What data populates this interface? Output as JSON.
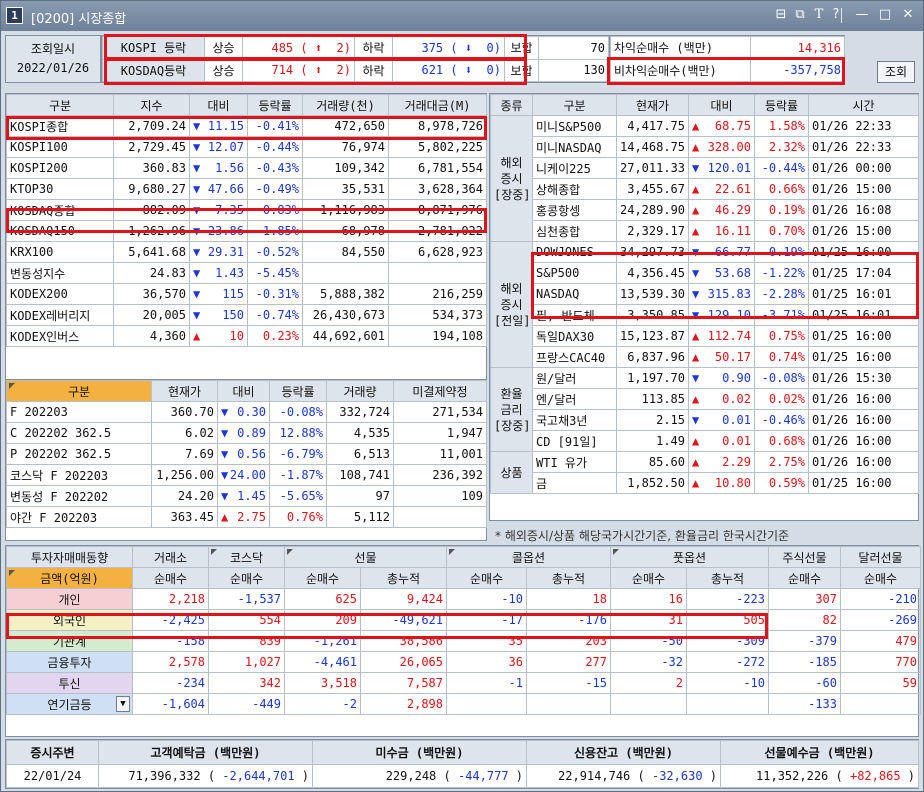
{
  "window": {
    "badge": "1",
    "title": "[0200] 시장종합",
    "controls": [
      "⊟",
      "⧉",
      "T",
      "?",
      "|",
      "—",
      "□",
      "✕"
    ]
  },
  "top": {
    "time_label": "조회일시",
    "date": "2022/01/26",
    "rows": [
      {
        "name": "KOSPI 등락",
        "up_label": "상승",
        "up_count": "485",
        "up_arrow": "⬆",
        "up_limit": "2",
        "down_label": "하락",
        "down_count": "375",
        "down_arrow": "⬇",
        "down_limit": "0",
        "extra_label": "보합",
        "extra_value": "70"
      },
      {
        "name": "KOSDAQ등락",
        "up_label": "상승",
        "up_count": "714",
        "up_arrow": "⬆",
        "up_limit": "2",
        "down_label": "하락",
        "down_count": "621",
        "down_arrow": "⬇",
        "down_limit": "0",
        "extra_label": "보합",
        "extra_value": "130"
      }
    ],
    "arb": [
      {
        "label": "차익순매수 (백만)",
        "value": "14,316"
      },
      {
        "label": "비차익순매수(백만)",
        "value": "-357,758"
      }
    ],
    "query_button": "조회"
  },
  "index_table": {
    "headers": [
      "구분",
      "지수",
      "대비",
      "등락률",
      "거래량(천)",
      "거래대금(M)"
    ],
    "rows": [
      {
        "name": "KOSPI종합",
        "value": "2,709.24",
        "dir": "down",
        "change": "11.15",
        "rate": "-0.41%",
        "volume": "472,650",
        "amount": "8,978,726"
      },
      {
        "name": "KOSPI100",
        "value": "2,729.45",
        "dir": "down",
        "change": "12.07",
        "rate": "-0.44%",
        "volume": "76,974",
        "amount": "5,802,225"
      },
      {
        "name": "KOSPI200",
        "value": "360.83",
        "dir": "down",
        "change": "1.56",
        "rate": "-0.43%",
        "volume": "109,342",
        "amount": "6,781,554"
      },
      {
        "name": "KTOP30",
        "value": "9,680.27",
        "dir": "down",
        "change": "47.66",
        "rate": "-0.49%",
        "volume": "35,531",
        "amount": "3,628,364"
      },
      {
        "name": "KOSDAQ종합",
        "value": "882.09",
        "dir": "down",
        "change": "7.35",
        "rate": "-0.83%",
        "volume": "1,116,983",
        "amount": "8,871,976"
      },
      {
        "name": "KOSDAQ150",
        "value": "1,262.96",
        "dir": "down",
        "change": "23.86",
        "rate": "-1.85%",
        "volume": "68,978",
        "amount": "2,781,022"
      },
      {
        "name": "KRX100",
        "value": "5,641.68",
        "dir": "down",
        "change": "29.31",
        "rate": "-0.52%",
        "volume": "84,550",
        "amount": "6,628,923"
      },
      {
        "name": "변동성지수",
        "value": "24.83",
        "dir": "down",
        "change": "1.43",
        "rate": "-5.45%",
        "volume": "",
        "amount": ""
      },
      {
        "name": "KODEX200",
        "value": "36,570",
        "dir": "down",
        "change": "115",
        "rate": "-0.31%",
        "volume": "5,888,382",
        "amount": "216,259"
      },
      {
        "name": "KODEX레버리지",
        "value": "20,005",
        "dir": "down",
        "change": "150",
        "rate": "-0.74%",
        "volume": "26,430,673",
        "amount": "534,373"
      },
      {
        "name": "KODEX인버스",
        "value": "4,360",
        "dir": "up",
        "change": "10",
        "rate": "0.23%",
        "volume": "44,692,601",
        "amount": "194,108"
      }
    ]
  },
  "futures_table": {
    "headers": [
      "구분",
      "현재가",
      "대비",
      "등락률",
      "거래량",
      "미결제약정"
    ],
    "rows": [
      {
        "name": "F 202203",
        "price": "360.70",
        "dir": "down",
        "change": "0.30",
        "rate": "-0.08%",
        "volume": "332,724",
        "oi": "271,534"
      },
      {
        "name": "C 202202 362.5",
        "price": "6.02",
        "dir": "down",
        "change": "0.89",
        "rate": "12.88%",
        "volume": "4,535",
        "oi": "1,947"
      },
      {
        "name": "P 202202 362.5",
        "price": "7.69",
        "dir": "down",
        "change": "0.56",
        "rate": "-6.79%",
        "volume": "6,513",
        "oi": "11,001"
      },
      {
        "name": "코스닥 F 202203",
        "price": "1,256.00",
        "dir": "down",
        "change": "24.00",
        "rate": "-1.87%",
        "volume": "108,741",
        "oi": "236,392"
      },
      {
        "name": "변동성 F 202202",
        "price": "24.20",
        "dir": "down",
        "change": "1.45",
        "rate": "-5.65%",
        "volume": "97",
        "oi": "109"
      },
      {
        "name": "야간 F 202203",
        "price": "363.45",
        "dir": "up",
        "change": "2.75",
        "rate": "0.76%",
        "volume": "5,112",
        "oi": ""
      }
    ]
  },
  "global_table": {
    "headers": [
      "종류",
      "구분",
      "현재가",
      "대비",
      "등락률",
      "시간"
    ],
    "groups": [
      {
        "label": [
          "해외",
          "증시",
          "[장중]"
        ],
        "rows": [
          {
            "name": "미니S&P500",
            "price": "4,417.75",
            "dir": "up",
            "change": "68.75",
            "rate": "1.58%",
            "time": "01/26 22:33"
          },
          {
            "name": "미니NASDAQ",
            "price": "14,468.75",
            "dir": "up",
            "change": "328.00",
            "rate": "2.32%",
            "time": "01/26 22:33"
          },
          {
            "name": "니케이225",
            "price": "27,011.33",
            "dir": "down",
            "change": "120.01",
            "rate": "-0.44%",
            "time": "01/26 00:00"
          },
          {
            "name": "상해종합",
            "price": "3,455.67",
            "dir": "up",
            "change": "22.61",
            "rate": "0.66%",
            "time": "01/26 15:00"
          },
          {
            "name": "홍콩항셍",
            "price": "24,289.90",
            "dir": "up",
            "change": "46.29",
            "rate": "0.19%",
            "time": "01/26 16:08"
          },
          {
            "name": "심천종합",
            "price": "2,329.17",
            "dir": "up",
            "change": "16.11",
            "rate": "0.70%",
            "time": "01/26 15:00"
          }
        ]
      },
      {
        "label": [
          "해외",
          "증시",
          "[전일]"
        ],
        "rows": [
          {
            "name": "DOWJONES",
            "price": "34,297.73",
            "dir": "down",
            "change": "66.77",
            "rate": "-0.19%",
            "time": "01/25 16:00"
          },
          {
            "name": "S&P500",
            "price": "4,356.45",
            "dir": "down",
            "change": "53.68",
            "rate": "-1.22%",
            "time": "01/25 17:04"
          },
          {
            "name": "NASDAQ",
            "price": "13,539.30",
            "dir": "down",
            "change": "315.83",
            "rate": "-2.28%",
            "time": "01/25 16:01"
          },
          {
            "name": "필, 반도체",
            "price": "3,350.85",
            "dir": "down",
            "change": "129.10",
            "rate": "-3.71%",
            "time": "01/25 16:01"
          },
          {
            "name": "독일DAX30",
            "price": "15,123.87",
            "dir": "up",
            "change": "112.74",
            "rate": "0.75%",
            "time": "01/25 16:00"
          },
          {
            "name": "프랑스CAC40",
            "price": "6,837.96",
            "dir": "up",
            "change": "50.17",
            "rate": "0.74%",
            "time": "01/25 16:00"
          }
        ]
      },
      {
        "label": [
          "환율",
          "금리",
          "[장중]"
        ],
        "rows": [
          {
            "name": "원/달러",
            "price": "1,197.70",
            "dir": "down",
            "change": "0.90",
            "rate": "-0.08%",
            "time": "01/26 15:30"
          },
          {
            "name": "엔/달러",
            "price": "113.85",
            "dir": "up",
            "change": "0.02",
            "rate": "0.02%",
            "time": "01/26 16:00"
          },
          {
            "name": "국고채3년",
            "price": "2.15",
            "dir": "down",
            "change": "0.01",
            "rate": "-0.46%",
            "time": "01/26 16:00"
          },
          {
            "name": "CD [91일]",
            "price": "1.49",
            "dir": "up",
            "change": "0.01",
            "rate": "0.68%",
            "time": "01/26 16:00"
          }
        ]
      },
      {
        "label": [
          "상품"
        ],
        "rows": [
          {
            "name": "WTI 유가",
            "price": "85.60",
            "dir": "up",
            "change": "2.29",
            "rate": "2.75%",
            "time": "01/26 16:00"
          },
          {
            "name": "금",
            "price": "1,852.50",
            "dir": "up",
            "change": "10.80",
            "rate": "0.59%",
            "time": "01/25 16:00"
          }
        ]
      }
    ],
    "note": "* 해외증시/상품 해당국가시간기준, 환율금리 한국시간기준"
  },
  "investor_table": {
    "corner": "투자자매매동향",
    "groups": [
      "거래소",
      "코스닥",
      "선물",
      "콜옵션",
      "풋옵션",
      "주식선물",
      "달러선물"
    ],
    "unit_label": "금액(억원)",
    "subheaders": [
      "순매수",
      "순매수",
      "순매수",
      "총누적",
      "순매수",
      "총누적",
      "순매수",
      "총누적",
      "순매수",
      "순매수"
    ],
    "rows": [
      {
        "name": "개인",
        "values": [
          "2,218",
          "-1,537",
          "625",
          "9,424",
          "-10",
          "18",
          "16",
          "-223",
          "307",
          "-210"
        ]
      },
      {
        "name": "외국인",
        "values": [
          "-2,425",
          "554",
          "209",
          "-49,621",
          "-17",
          "-176",
          "31",
          "505",
          "82",
          "-269"
        ]
      },
      {
        "name": "기관계",
        "values": [
          "-158",
          "839",
          "-1,261",
          "38,586",
          "35",
          "203",
          "-50",
          "-309",
          "-379",
          "479"
        ]
      },
      {
        "name": "금융투자",
        "values": [
          "2,578",
          "1,027",
          "-4,461",
          "26,065",
          "36",
          "277",
          "-32",
          "-272",
          "-185",
          "770"
        ]
      },
      {
        "name": "투신",
        "values": [
          "-234",
          "342",
          "3,518",
          "7,587",
          "-1",
          "-15",
          "2",
          "-10",
          "-60",
          "59"
        ]
      },
      {
        "name": "연기금등",
        "values": [
          "-1,604",
          "-449",
          "-2",
          "2,898",
          "",
          "",
          "",
          "",
          "-133",
          ""
        ]
      }
    ]
  },
  "bottom": {
    "headers": [
      "증시주변",
      "고객예탁금 (백만원)",
      "미수금 (백만원)",
      "신용잔고 (백만원)",
      "선물예수금 (백만원)"
    ],
    "date": "22/01/24",
    "deposit": "71,396,332",
    "deposit_change": "-2,644,701",
    "receivable": "229,248",
    "receivable_change": "-44,777",
    "credit": "22,914,746",
    "credit_change": "-32,630",
    "fut_deposit": "11,352,226",
    "fut_deposit_change": "+82,865"
  },
  "colors": {
    "red": "#e0141a",
    "blue": "#1a35d8",
    "highlight": "#e0121a",
    "header": "#dde4eb",
    "orange": "#f4b13f"
  }
}
